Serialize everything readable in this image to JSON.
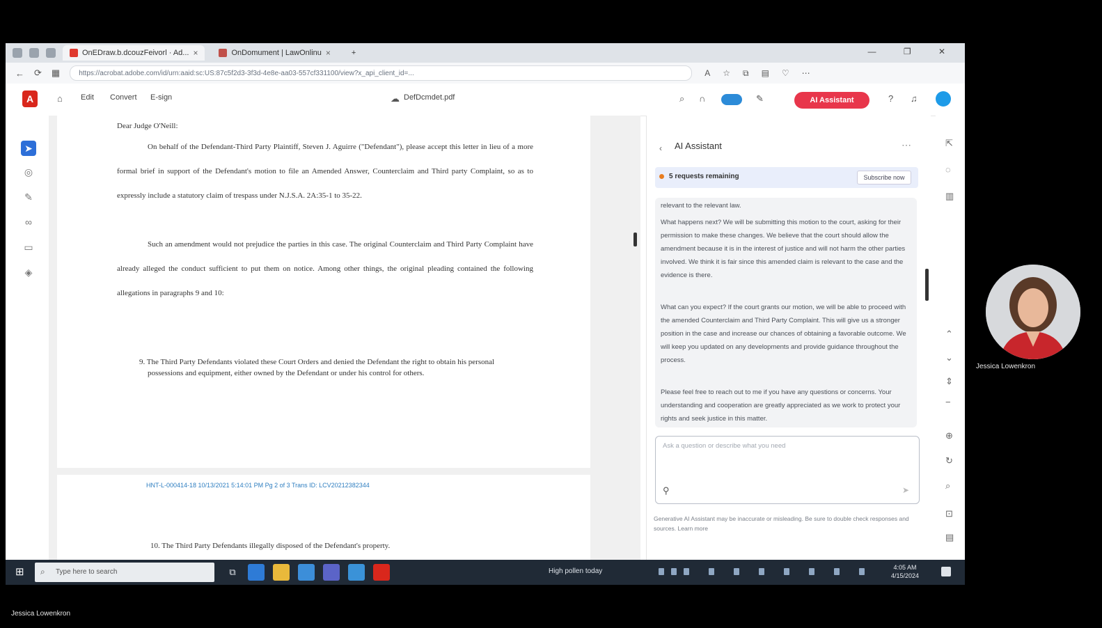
{
  "browser": {
    "tabs": [
      {
        "label": "OnEDraw.b.dcouzFeivorl · Ad..."
      },
      {
        "label": "OnDomument | LawOnlinu"
      }
    ],
    "url": "https://acrobat.adobe.com/id/urn:aaid:sc:US:87c5f2d3-3f3d-4e8e-aa03-557cf331100/view?x_api_client_id=..."
  },
  "acrobat": {
    "logo": "A",
    "menu": [
      "Edit",
      "Convert",
      "E-sign"
    ],
    "doc_name": "DefDcmdet.pdf",
    "ai_button": "AI Assistant"
  },
  "document": {
    "paragraphs": [
      "Dear Judge O'Neill:",
      "On behalf of the Defendant-Third Party Plaintiff, Steven J. Aguirre (\"Defendant\"), please accept this letter in lieu of a more formal brief in support of the Defendant's motion to file an Amended Answer, Counterclaim and Third party Complaint, so as to expressly include a statutory claim of trespass under N.J.S.A. 2A:35-1 to 35-22.",
      "Such an amendment would not prejudice the parties in this case. The original Counterclaim and Third Party Complaint have already alleged the conduct sufficient to put them on notice. Among other things, the original pleading contained the following allegations in paragraphs 9 and 10:"
    ],
    "list_item": "9.  The Third Party Defendants violated these Court Orders and denied the Defendant the right to obtain his personal possessions and equipment, either owned by the Defendant or under his control for others.",
    "stamp": "HNT-L-000414-18   10/13/2021 5:14:01 PM  Pg 2 of 3  Trans ID: LCV20212382344",
    "page2_item": "10.  The Third Party Defendants illegally disposed of the Defendant's property."
  },
  "ai_panel": {
    "title": "AI Assistant",
    "request_banner": "5 requests remaining",
    "subscribe_label": "Subscribe now",
    "chat": [
      "relevant to the relevant law.",
      "What happens next? We will be submitting this motion to the court, asking for their permission to make these changes. We believe that the court should allow the amendment because it is in the interest of justice and will not harm the other parties involved. We think it is fair since this amended claim is relevant to the case and the evidence is there.",
      "What can you expect? If the court grants our motion, we will be able to proceed with the amended Counterclaim and Third Party Complaint. This will give us a stronger position in the case and increase our chances of obtaining a favorable outcome. We will keep you updated on any developments and provide guidance throughout the process.",
      "Please feel free to reach out to me if you have any questions or concerns. Your understanding and cooperation are greatly appreciated as we work to protect your rights and seek justice in this matter."
    ],
    "input_placeholder": "Ask a question or describe what you need",
    "disclaimer": "Generative AI Assistant may be inaccurate or misleading. Be sure to double check responses and sources. Learn more"
  },
  "taskbar": {
    "search_placeholder": "Type here to search",
    "weather": "High pollen today",
    "time": "4:05 AM",
    "date": "4/15/2024"
  },
  "webcam": {
    "participant_name": "Jessica Lowenkron",
    "presenter_name": "Jessica Lowenkron"
  }
}
